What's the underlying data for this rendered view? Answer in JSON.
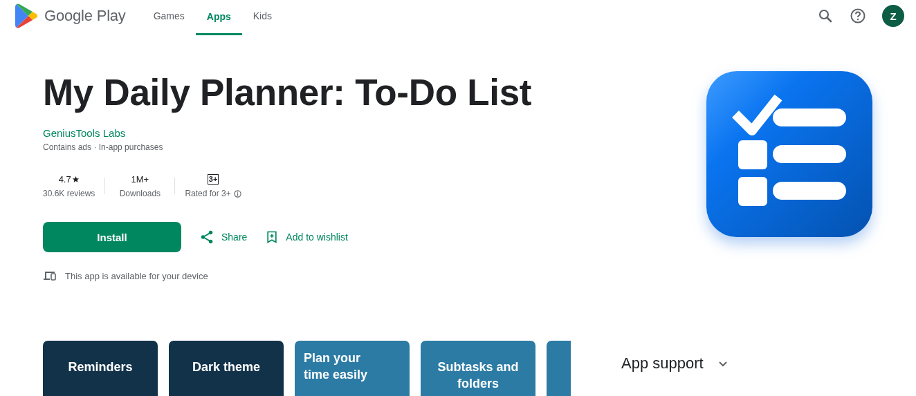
{
  "header": {
    "brand": "Google Play",
    "tabs": [
      {
        "label": "Games",
        "selected": false
      },
      {
        "label": "Apps",
        "selected": true
      },
      {
        "label": "Kids",
        "selected": false
      }
    ],
    "avatar": "Z"
  },
  "app": {
    "title": "My Daily Planner: To-Do List",
    "developer": "GeniusTools Labs",
    "notes": "Contains ads · In-app purchases",
    "stats": [
      {
        "kind": "rating",
        "value": "4.7",
        "label": "30.6K reviews"
      },
      {
        "kind": "plain",
        "value": "1M+",
        "label": "Downloads"
      },
      {
        "kind": "content",
        "value": "3+",
        "label": "Rated for 3+"
      }
    ],
    "install": "Install",
    "share": "Share",
    "wishlist": "Add to wishlist",
    "device_note": "This app is available for your device"
  },
  "screenshots": [
    {
      "caption": "Reminders",
      "kind": "centered",
      "color": "#12324a"
    },
    {
      "caption": "Dark theme",
      "kind": "centered",
      "color": "#12324a"
    },
    {
      "caption": "Plan your time easily",
      "kind": "flush",
      "color": "#2c7ba4"
    },
    {
      "caption": "Subtasks and folders",
      "kind": "centered",
      "color": "#2c7ba4"
    },
    {
      "color": "#2c7ba4"
    }
  ],
  "app_support": {
    "label": "App support",
    "expanded": false
  }
}
